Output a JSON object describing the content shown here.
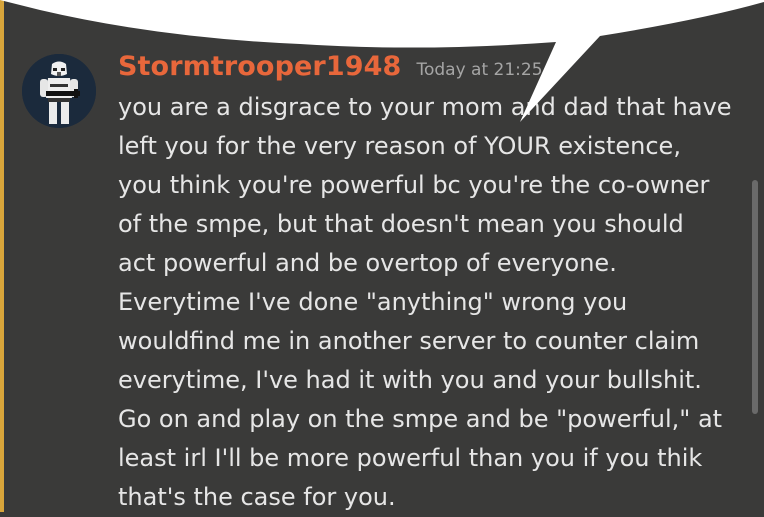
{
  "message": {
    "username": "Stormtrooper1948",
    "timestamp": "Today at 21:25",
    "lines": [
      "you are a disgrace to your mom and dad that have",
      "left you for the very reason of YOUR existence,",
      "you think you're powerful bc you're the co-owner",
      "of the smpe, but that doesn't mean you should",
      "act powerful and be overtop of everyone.",
      "Everytime I've done \"anything\" wrong you",
      "wouldfind me in another server to counter claim",
      "everytime, I've had it with you and your bullshit.",
      "Go on and play on the smpe and be \"powerful,\" at",
      "least irl I'll be more powerful than you if you thik",
      "that's the case for you."
    ]
  },
  "avatar_icon": "stormtrooper-icon",
  "colors": {
    "background": "#3a3a39",
    "username": "#e8673b",
    "timestamp": "#a5a5a5",
    "text": "#e6e6e6",
    "mention_bar": "#d8a53b"
  }
}
